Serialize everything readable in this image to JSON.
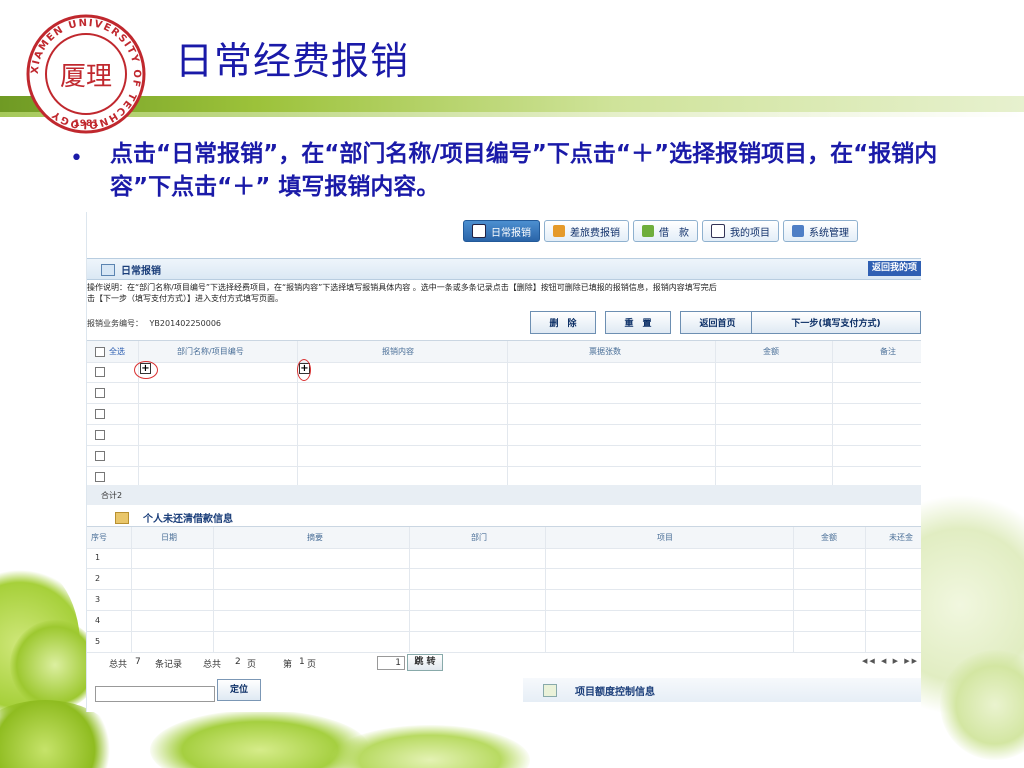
{
  "slide": {
    "title": "日常经费报销",
    "bullet": "点击“日常报销”，在“部门名称/项目编号”下点击“＋”选择报销项目，在“报销内容”下点击“＋” 填写报销内容。",
    "logo": {
      "ring_text": "XIAMEN UNIVERSITY OF TECHNOLOGY",
      "year": "1981",
      "center": "厦理",
      "color": "#c0282e"
    },
    "colors": {
      "title": "#1a1aa8",
      "band": "#9cc23a"
    }
  },
  "app": {
    "nav": [
      {
        "label": "日常报销",
        "active": true,
        "icon": "document-icon"
      },
      {
        "label": "差旅费报销",
        "active": false,
        "icon": "truck-icon"
      },
      {
        "label": "借　款",
        "active": false,
        "icon": "loan-icon"
      },
      {
        "label": "我的项目",
        "active": false,
        "icon": "list-icon"
      },
      {
        "label": "系统管理",
        "active": false,
        "icon": "settings-icon"
      }
    ],
    "section_title": "日常报销",
    "return_label": "返回我的项",
    "instruction_line1": "操作说明：在“部门名称/项目编号”下选择经费项目，在“报销内容”下选择填写报销具体内容 。选中一条或多条记录点击【删除】按钮可删除已填报的报销信息，报销内容填写完后",
    "instruction_line2": "击【下一步（填写支付方式）】进入支付方式填写页面。",
    "business_no_label": "报销业务编号：",
    "business_no": "YB201402250006",
    "buttons": {
      "delete": "删　除",
      "reset": "重　置",
      "home": "返回首页",
      "next": "下一步(填写支付方式)"
    },
    "table": {
      "select_all": "全选",
      "headers": [
        "部门名称/项目编号",
        "报销内容",
        "票据张数",
        "金额",
        "备注"
      ],
      "plus_symbol": "+"
    },
    "total_label": "合计2",
    "loan": {
      "title": "个人未还清借款信息",
      "headers": [
        "序号",
        "日期",
        "摘要",
        "部门",
        "项目",
        "金额",
        "未还金"
      ],
      "row_numbers": [
        "1",
        "2",
        "3",
        "4",
        "5"
      ]
    },
    "pager": {
      "total_records_a": "总共",
      "total_records_n": "7",
      "total_records_b": "条记录",
      "total_pages_a": "总共",
      "total_pages_n": "2",
      "total_pages_b": "页",
      "current_a": "第",
      "current_n": "1",
      "current_b": "页",
      "page_input": "1",
      "jump": "跳 转",
      "arrows": "◀◀ ◀ ▶ ▶▶"
    },
    "locate_button": "定位",
    "budget_title": "项目额度控制信息"
  }
}
